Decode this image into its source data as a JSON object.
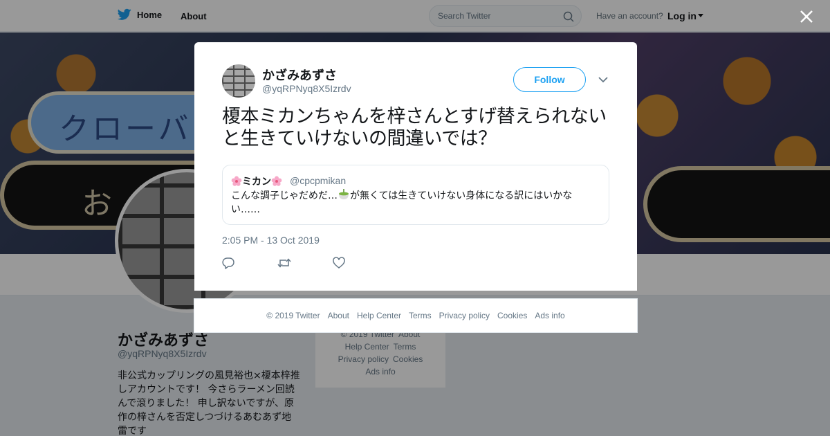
{
  "topbar": {
    "home_label": "Home",
    "about_label": "About",
    "search_placeholder": "Search Twitter",
    "account_prompt": "Have an account?",
    "login_label": "Log in"
  },
  "banner": {
    "pill_text": "クローバ",
    "dark_text": "お"
  },
  "profile": {
    "name": "かざみあずさ",
    "handle": "@yqRPNyq8X5Izrdv",
    "bio": "非公式カップリングの風見裕也×榎本梓推しアカウントです！ 今さらラーメン回読んで滾りました！ 申し訳ないですが、原作の梓さんを否定しつづけるあむあず地雷です"
  },
  "side_footer": {
    "items": [
      "© 2019 Twitter",
      "About",
      "Help Center",
      "Terms",
      "Privacy policy",
      "Cookies",
      "Ads info"
    ]
  },
  "tweet": {
    "author_name": "かざみあずさ",
    "author_handle": "@yqRPNyq8X5Izrdv",
    "follow_label": "Follow",
    "text": "榎本ミカンちゃんを梓さんとすげ替えられないと生きていけないの間違いでは？",
    "timestamp": "2:05 PM - 13 Oct 2019",
    "quote": {
      "name": "ミカン",
      "handle": "@cpcpmikan",
      "text_before": "こんな調子じゃだめだ…",
      "text_after": "が無くては生きていけない身体になる訳にはいかない……"
    },
    "actions": [
      "reply-icon",
      "retweet-icon",
      "like-icon"
    ]
  },
  "footer": {
    "copyright": "© 2019 Twitter",
    "about": "About",
    "help": "Help Center",
    "terms": "Terms",
    "privacy": "Privacy policy",
    "cookies": "Cookies",
    "ads": "Ads info"
  },
  "colors": {
    "brand": "#1da1f2",
    "muted_text": "#657786"
  }
}
